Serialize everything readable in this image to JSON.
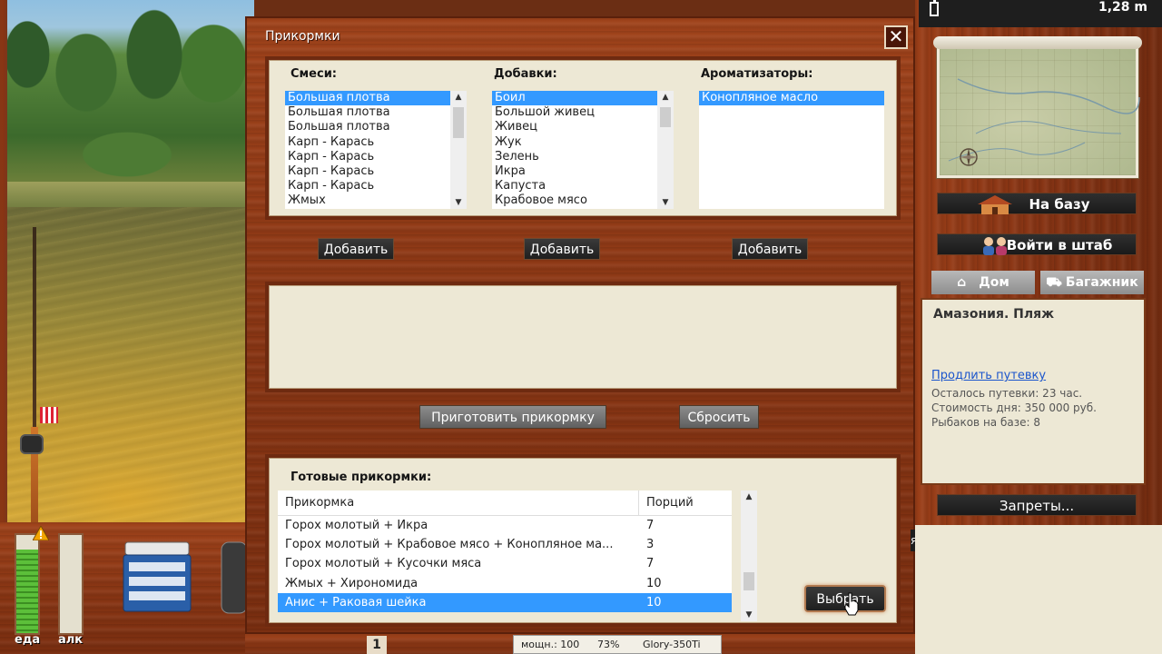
{
  "dialog": {
    "title": "Прикормки",
    "close_glyph": "✕",
    "columns": [
      {
        "title": "Смеси:",
        "items": [
          "Большая плотва",
          "Большая плотва",
          "Большая плотва",
          "Карп - Карась",
          "Карп - Карась",
          "Карп - Карась",
          "Карп - Карась",
          "Жмых"
        ],
        "selected": 0
      },
      {
        "title": "Добавки:",
        "items": [
          "Боил",
          "Большой живец",
          "Живец",
          "Жук",
          "Зелень",
          "Икра",
          "Капуста",
          "Крабовое мясо"
        ],
        "selected": 0
      },
      {
        "title": "Ароматизаторы:",
        "items": [
          "Конопляное масло"
        ],
        "selected": 0
      }
    ],
    "add_label": "Добавить",
    "prepare_label": "Приготовить прикормку",
    "reset_label": "Сбросить",
    "ready": {
      "title": "Готовые прикормки:",
      "headers": [
        "Прикормка",
        "Порций"
      ],
      "rows": [
        [
          "Горох молотый + Икра",
          "7"
        ],
        [
          "Горох молотый + Крабовое мясо + Конопляное ма...",
          "3"
        ],
        [
          "Горох молотый + Кусочки мяса",
          "7"
        ],
        [
          "Жмых + Хирономида",
          "10"
        ],
        [
          "Анис + Раковая шейка",
          "10"
        ]
      ],
      "selected": 4
    },
    "select_label": "Выбрать"
  },
  "sidebar": {
    "depth": "1,28 m",
    "to_base_label": "На базу",
    "enter_hq_label": "Войти в штаб",
    "home_tab": "Дом",
    "trunk_tab": "Багажник",
    "location_title": "Амазония. Пляж",
    "extend_link": "Продлить путевку",
    "info_lines": [
      "Осталось путевки: 23 час.",
      "Стоимость дня: 350 000 руб.",
      "Рыбаков на базе: 8"
    ],
    "bans_label": "Запреты..."
  },
  "hud": {
    "food_label": "еда",
    "alc_label": "алк",
    "food_level": 0.85,
    "alc_level": 0.0,
    "slot_number": "1",
    "power_label": "мощн.: 100",
    "power_pct": "73%",
    "rod_name": "Glory-350Ti",
    "dark_tab_text": "я"
  },
  "colors": {
    "selection": "#3399ff",
    "panel_bg": "#ede8d5",
    "wood": "#8a3614"
  }
}
